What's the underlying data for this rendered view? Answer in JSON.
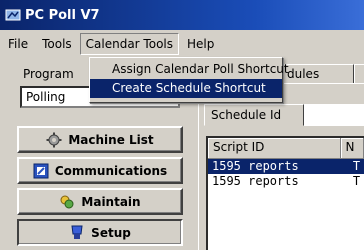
{
  "window": {
    "title": "PC Poll V7"
  },
  "menubar": {
    "items": [
      {
        "label": "File"
      },
      {
        "label": "Tools"
      },
      {
        "label": "Calendar Tools"
      },
      {
        "label": "Help"
      }
    ]
  },
  "calendar_menu": {
    "items": [
      {
        "label": "Assign Calendar Poll Shortcut"
      },
      {
        "label": "Create Schedule Shortcut"
      }
    ]
  },
  "left_panel": {
    "program_label": "Program",
    "program_value": "Polling",
    "nav": [
      {
        "label": "Machine List",
        "icon": "gear-icon"
      },
      {
        "label": "Communications",
        "icon": "communications-icon"
      },
      {
        "label": "Maintain",
        "icon": "maintain-icon"
      },
      {
        "label": "Setup",
        "icon": "setup-icon"
      }
    ]
  },
  "right_panel": {
    "partial_tab": "dules",
    "schedule_tab": "Schedule Id",
    "list_header": [
      "Script ID",
      "N"
    ],
    "rows": [
      {
        "script_id": "1595 reports",
        "extra": "T"
      },
      {
        "script_id": "1595 reports",
        "extra": "T"
      }
    ]
  },
  "colors": {
    "title_bar": "#0a246a",
    "selection": "#0a246a",
    "face": "#d4d0c8"
  }
}
